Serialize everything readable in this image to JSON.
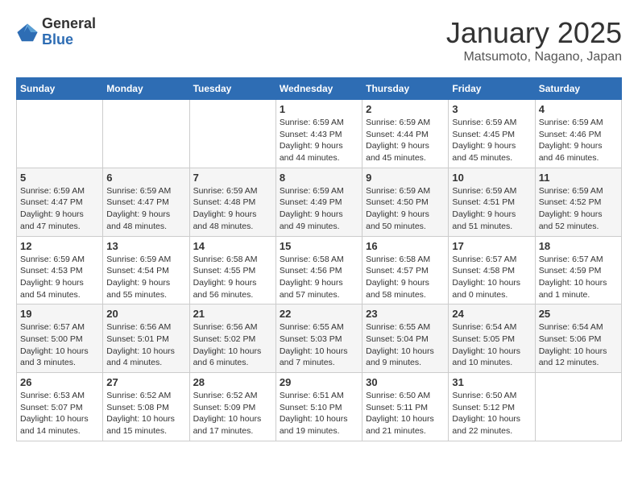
{
  "header": {
    "logo_general": "General",
    "logo_blue": "Blue",
    "month_title": "January 2025",
    "location": "Matsumoto, Nagano, Japan"
  },
  "weekdays": [
    "Sunday",
    "Monday",
    "Tuesday",
    "Wednesday",
    "Thursday",
    "Friday",
    "Saturday"
  ],
  "weeks": [
    [
      {
        "day": "",
        "info": ""
      },
      {
        "day": "",
        "info": ""
      },
      {
        "day": "",
        "info": ""
      },
      {
        "day": "1",
        "info": "Sunrise: 6:59 AM\nSunset: 4:43 PM\nDaylight: 9 hours\nand 44 minutes."
      },
      {
        "day": "2",
        "info": "Sunrise: 6:59 AM\nSunset: 4:44 PM\nDaylight: 9 hours\nand 45 minutes."
      },
      {
        "day": "3",
        "info": "Sunrise: 6:59 AM\nSunset: 4:45 PM\nDaylight: 9 hours\nand 45 minutes."
      },
      {
        "day": "4",
        "info": "Sunrise: 6:59 AM\nSunset: 4:46 PM\nDaylight: 9 hours\nand 46 minutes."
      }
    ],
    [
      {
        "day": "5",
        "info": "Sunrise: 6:59 AM\nSunset: 4:47 PM\nDaylight: 9 hours\nand 47 minutes."
      },
      {
        "day": "6",
        "info": "Sunrise: 6:59 AM\nSunset: 4:47 PM\nDaylight: 9 hours\nand 48 minutes."
      },
      {
        "day": "7",
        "info": "Sunrise: 6:59 AM\nSunset: 4:48 PM\nDaylight: 9 hours\nand 48 minutes."
      },
      {
        "day": "8",
        "info": "Sunrise: 6:59 AM\nSunset: 4:49 PM\nDaylight: 9 hours\nand 49 minutes."
      },
      {
        "day": "9",
        "info": "Sunrise: 6:59 AM\nSunset: 4:50 PM\nDaylight: 9 hours\nand 50 minutes."
      },
      {
        "day": "10",
        "info": "Sunrise: 6:59 AM\nSunset: 4:51 PM\nDaylight: 9 hours\nand 51 minutes."
      },
      {
        "day": "11",
        "info": "Sunrise: 6:59 AM\nSunset: 4:52 PM\nDaylight: 9 hours\nand 52 minutes."
      }
    ],
    [
      {
        "day": "12",
        "info": "Sunrise: 6:59 AM\nSunset: 4:53 PM\nDaylight: 9 hours\nand 54 minutes."
      },
      {
        "day": "13",
        "info": "Sunrise: 6:59 AM\nSunset: 4:54 PM\nDaylight: 9 hours\nand 55 minutes."
      },
      {
        "day": "14",
        "info": "Sunrise: 6:58 AM\nSunset: 4:55 PM\nDaylight: 9 hours\nand 56 minutes."
      },
      {
        "day": "15",
        "info": "Sunrise: 6:58 AM\nSunset: 4:56 PM\nDaylight: 9 hours\nand 57 minutes."
      },
      {
        "day": "16",
        "info": "Sunrise: 6:58 AM\nSunset: 4:57 PM\nDaylight: 9 hours\nand 58 minutes."
      },
      {
        "day": "17",
        "info": "Sunrise: 6:57 AM\nSunset: 4:58 PM\nDaylight: 10 hours\nand 0 minutes."
      },
      {
        "day": "18",
        "info": "Sunrise: 6:57 AM\nSunset: 4:59 PM\nDaylight: 10 hours\nand 1 minute."
      }
    ],
    [
      {
        "day": "19",
        "info": "Sunrise: 6:57 AM\nSunset: 5:00 PM\nDaylight: 10 hours\nand 3 minutes."
      },
      {
        "day": "20",
        "info": "Sunrise: 6:56 AM\nSunset: 5:01 PM\nDaylight: 10 hours\nand 4 minutes."
      },
      {
        "day": "21",
        "info": "Sunrise: 6:56 AM\nSunset: 5:02 PM\nDaylight: 10 hours\nand 6 minutes."
      },
      {
        "day": "22",
        "info": "Sunrise: 6:55 AM\nSunset: 5:03 PM\nDaylight: 10 hours\nand 7 minutes."
      },
      {
        "day": "23",
        "info": "Sunrise: 6:55 AM\nSunset: 5:04 PM\nDaylight: 10 hours\nand 9 minutes."
      },
      {
        "day": "24",
        "info": "Sunrise: 6:54 AM\nSunset: 5:05 PM\nDaylight: 10 hours\nand 10 minutes."
      },
      {
        "day": "25",
        "info": "Sunrise: 6:54 AM\nSunset: 5:06 PM\nDaylight: 10 hours\nand 12 minutes."
      }
    ],
    [
      {
        "day": "26",
        "info": "Sunrise: 6:53 AM\nSunset: 5:07 PM\nDaylight: 10 hours\nand 14 minutes."
      },
      {
        "day": "27",
        "info": "Sunrise: 6:52 AM\nSunset: 5:08 PM\nDaylight: 10 hours\nand 15 minutes."
      },
      {
        "day": "28",
        "info": "Sunrise: 6:52 AM\nSunset: 5:09 PM\nDaylight: 10 hours\nand 17 minutes."
      },
      {
        "day": "29",
        "info": "Sunrise: 6:51 AM\nSunset: 5:10 PM\nDaylight: 10 hours\nand 19 minutes."
      },
      {
        "day": "30",
        "info": "Sunrise: 6:50 AM\nSunset: 5:11 PM\nDaylight: 10 hours\nand 21 minutes."
      },
      {
        "day": "31",
        "info": "Sunrise: 6:50 AM\nSunset: 5:12 PM\nDaylight: 10 hours\nand 22 minutes."
      },
      {
        "day": "",
        "info": ""
      }
    ]
  ]
}
